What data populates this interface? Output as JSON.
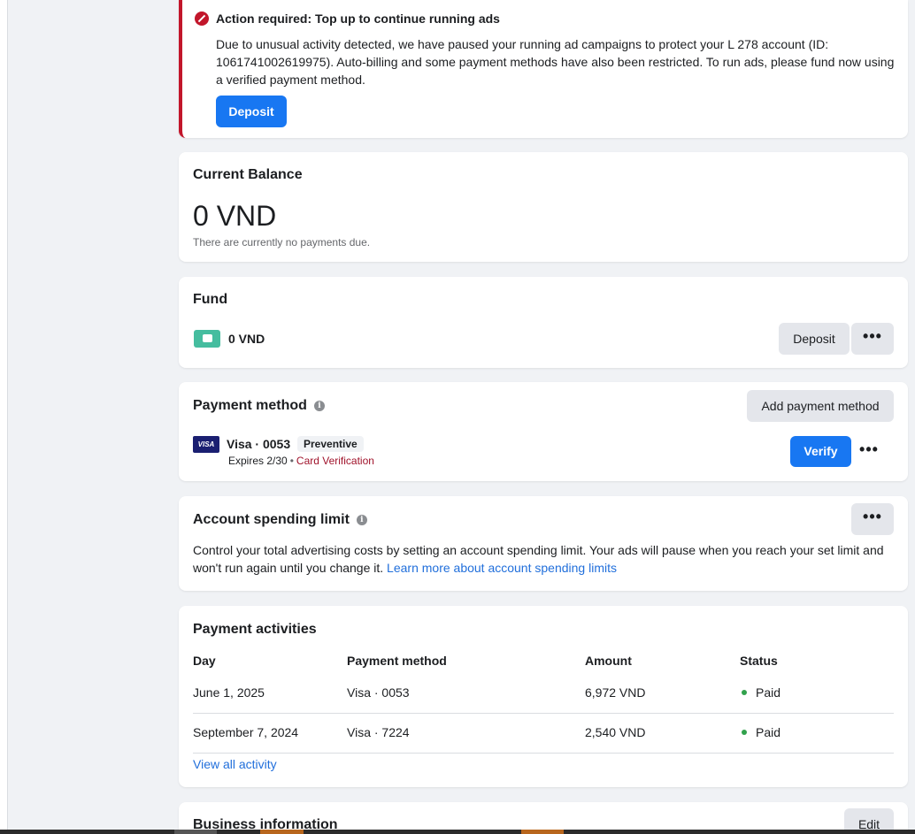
{
  "alert": {
    "title": "Action required: Top up to continue running ads",
    "body": "Due to unusual activity detected, we have paused your running ad campaigns to protect your L 278 account (ID: 1061741002619975). Auto-billing and some payment methods have also been restricted. To run ads, please fund now using a verified payment method.",
    "deposit_label": "Deposit",
    "accent_color": "#c2162b"
  },
  "balance": {
    "title": "Current Balance",
    "amount": "0 VND",
    "note": "There are currently no payments due."
  },
  "fund": {
    "title": "Fund",
    "amount": "0 VND",
    "deposit_label": "Deposit",
    "more_label": "•••"
  },
  "payment_method": {
    "title": "Payment method",
    "info": "i",
    "add_label": "Add payment method",
    "card_brand_logo": "VISA",
    "card_name": "Visa · 0053",
    "badge": "Preventive",
    "expiry": "Expires 2/30",
    "separator": "•",
    "verification": "Card Verification",
    "verify_label": "Verify",
    "more_label": "•••"
  },
  "spending_limit": {
    "title": "Account spending limit",
    "info": "i",
    "more_label": "•••",
    "description": "Control your total advertising costs by setting an account spending limit. Your ads will pause when you reach your set limit and won't run again until you change it.",
    "learn_more": "Learn more about account spending limits"
  },
  "activities": {
    "title": "Payment activities",
    "columns": [
      "Day",
      "Payment method",
      "Amount",
      "Status"
    ],
    "rows": [
      {
        "day": "June 1, 2025",
        "method": "Visa · 0053",
        "amount": "6,972 VND",
        "status": "Paid"
      },
      {
        "day": "September 7, 2024",
        "method": "Visa · 7224",
        "amount": "2,540 VND",
        "status": "Paid"
      }
    ],
    "view_all": "View all activity",
    "status_color": "#31a24c"
  },
  "business": {
    "title": "Business information",
    "edit_label": "Edit"
  },
  "colors": {
    "primary": "#1877f2",
    "link": "#216fdb",
    "background": "#f0f2f5"
  }
}
